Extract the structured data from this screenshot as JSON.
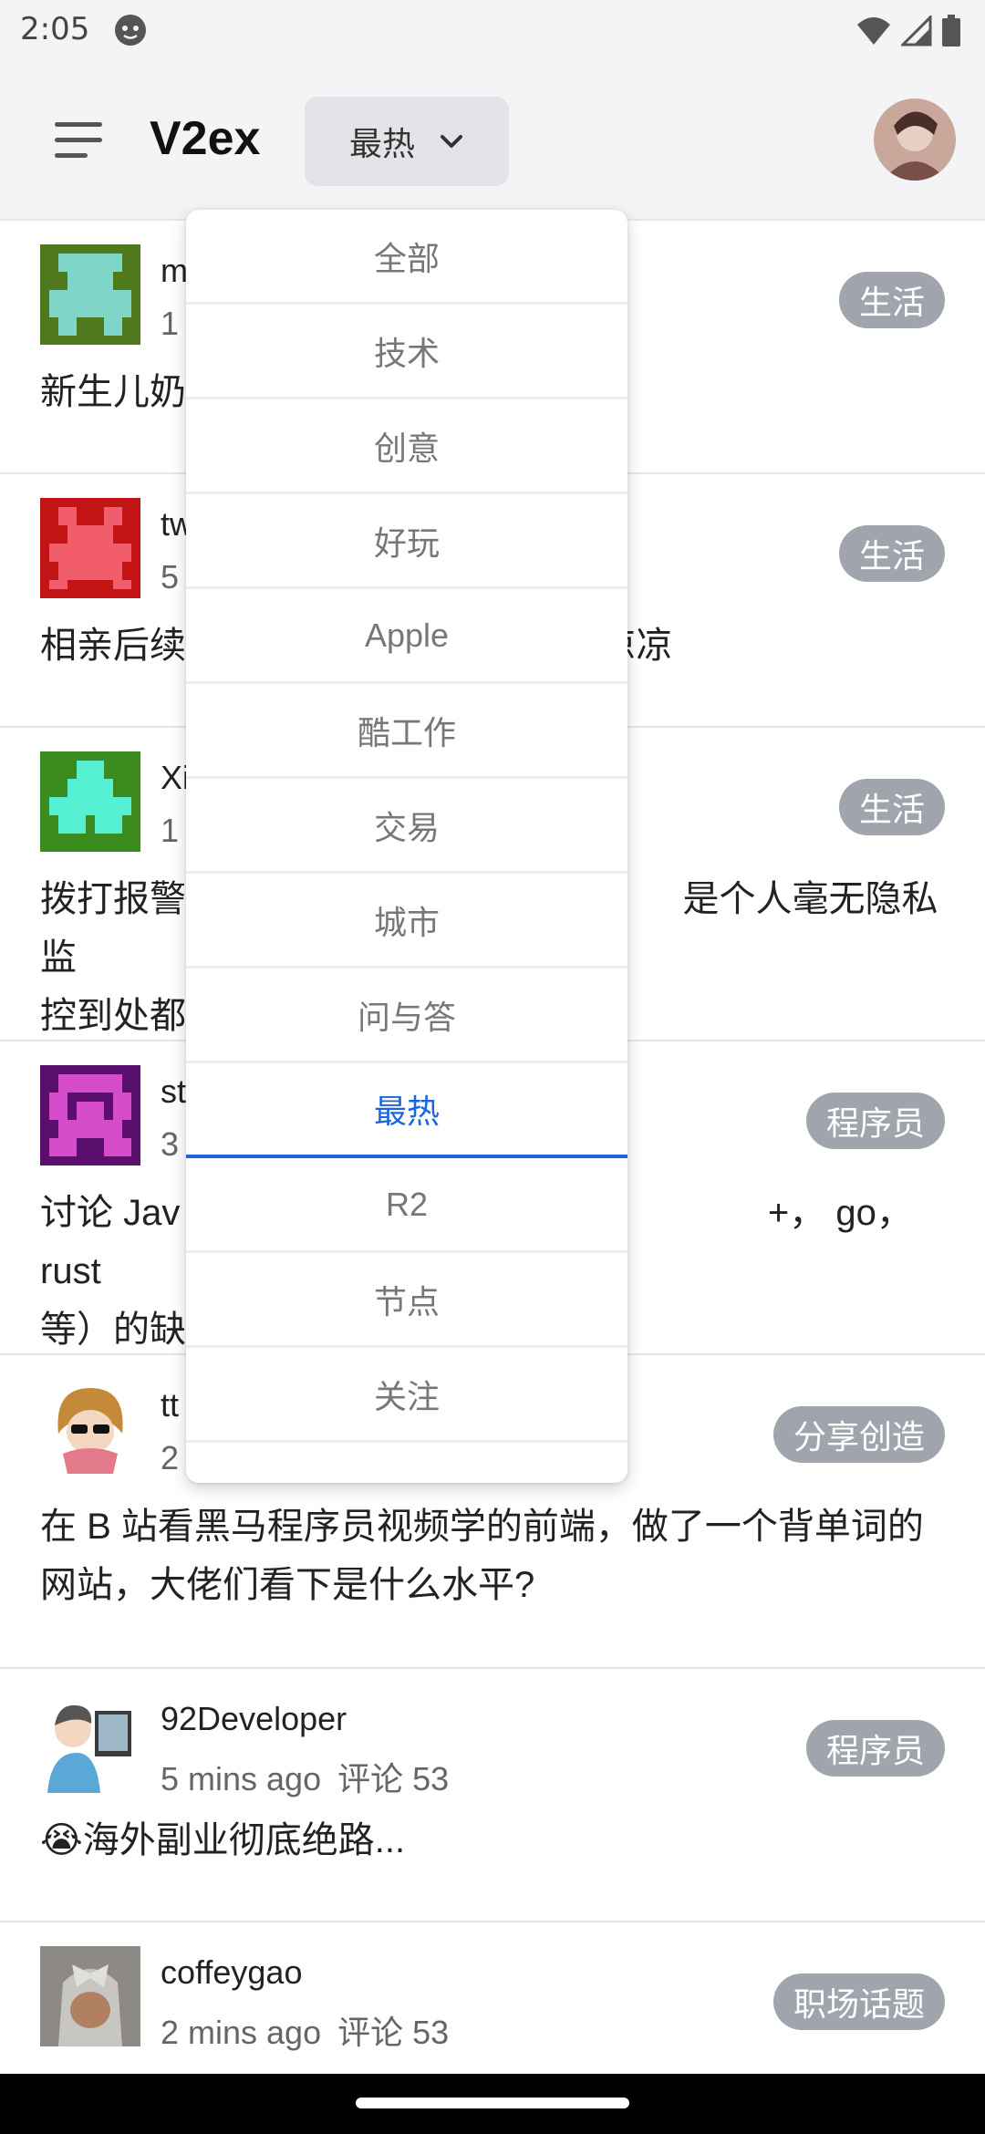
{
  "status_bar": {
    "time": "2:05"
  },
  "app_bar": {
    "title": "V2ex",
    "current_tab": "最热"
  },
  "dropdown": {
    "items": [
      "全部",
      "技术",
      "创意",
      "好玩",
      "Apple",
      "酷工作",
      "交易",
      "城市",
      "问与答",
      "最热",
      "R2",
      "节点",
      "关注"
    ],
    "selected": "最热"
  },
  "posts": [
    {
      "author": "m",
      "time": "1",
      "comments": "",
      "node": "生活",
      "title": "新生儿奶"
    },
    {
      "author": "tw",
      "time": "5",
      "comments": "",
      "node": "生活",
      "title": "相亲后续                              感觉要凉凉"
    },
    {
      "author": "Xi",
      "time": "1",
      "comments": "",
      "node": "生活",
      "title": "拨打报警                              是个人毫无隐私 监控到处都"
    },
    {
      "author": "st",
      "time": "3",
      "comments": "",
      "node": "程序员",
      "title": "讨论 Jav                              ++， go， rust 等）的缺"
    },
    {
      "author": "tt",
      "time": "2",
      "comments": "",
      "node": "分享创造",
      "title": "在 B 站看黑马程序员视频学的前端，做了一个背单词的网站，大佬们看下是什么水平?"
    },
    {
      "author": "92Developer",
      "time": "5 mins ago",
      "comments": "评论 53",
      "node": "程序员",
      "title": "😭海外副业彻底绝路..."
    },
    {
      "author": "coffeygao",
      "time": "2 mins ago",
      "comments": "评论 53",
      "node": "职场话题",
      "title": ""
    }
  ],
  "colors": {
    "accent": "#1b66e0",
    "node_badge": "#a0a4ac",
    "app_bar_bg": "#f4f4f6"
  }
}
